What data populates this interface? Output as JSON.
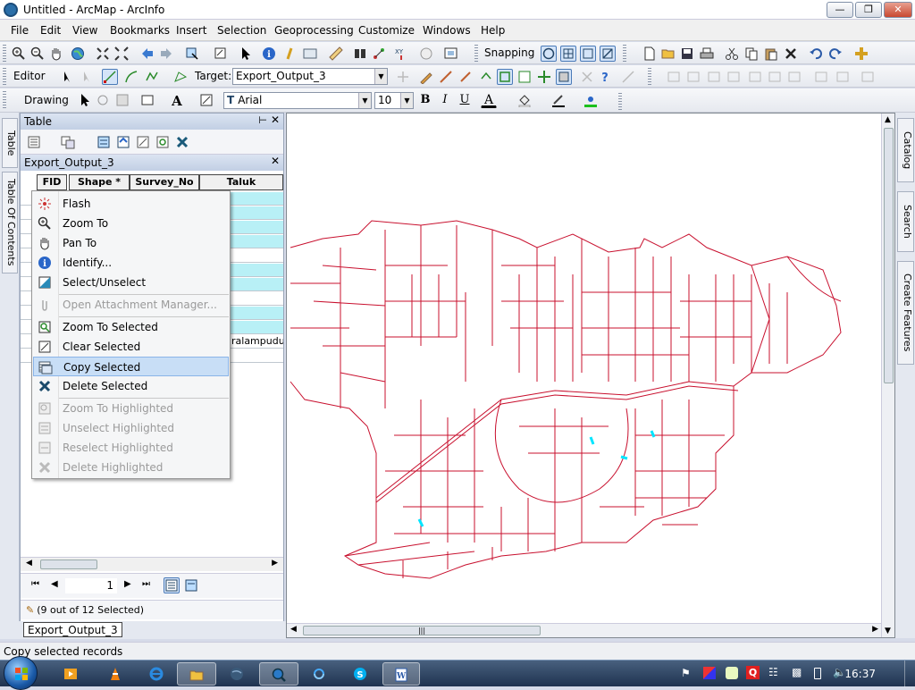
{
  "window": {
    "title": "Untitled - ArcMap - ArcInfo"
  },
  "menubar": [
    "File",
    "Edit",
    "View",
    "Bookmarks",
    "Insert",
    "Selection",
    "Geoprocessing",
    "Customize",
    "Windows",
    "Help"
  ],
  "toolbar1": {
    "snapping_label": "Snapping"
  },
  "editor_toolbar": {
    "editor_label": "Editor",
    "target_label": "Target:",
    "target_value": "Export_Output_3"
  },
  "drawing_toolbar": {
    "drawing_label": "Drawing",
    "font_name": "Arial",
    "font_size": "10",
    "bold": "B",
    "italic": "I",
    "underline": "U",
    "font_color_letter": "A"
  },
  "left_tabs": {
    "table": "Table",
    "toc": "Table Of Contents"
  },
  "table_window": {
    "title": "Table",
    "layer_name": "Export_Output_3",
    "columns": [
      "FID",
      "Shape *",
      "Survey_No",
      "Taluk"
    ],
    "partial_cell_text": "ralampudur",
    "record_number": "1",
    "selection_status": "(9 out of 12 Selected)"
  },
  "context_menu": {
    "items": [
      {
        "label": "Flash",
        "icon": "flash-icon",
        "enabled": true
      },
      {
        "label": "Zoom To",
        "icon": "zoom-to-icon",
        "enabled": true
      },
      {
        "label": "Pan To",
        "icon": "pan-hand-icon",
        "enabled": true
      },
      {
        "label": "Identify...",
        "icon": "identify-icon",
        "enabled": true
      },
      {
        "label": "Select/Unselect",
        "icon": "select-unselect-icon",
        "enabled": true
      },
      {
        "label": "Open Attachment Manager...",
        "icon": "paperclip-icon",
        "enabled": false
      },
      {
        "label": "Zoom To Selected",
        "icon": "zoom-selected-icon",
        "enabled": true
      },
      {
        "label": "Clear Selected",
        "icon": "clear-selected-icon",
        "enabled": true
      },
      {
        "label": "Copy Selected",
        "icon": "copy-selected-icon",
        "enabled": true,
        "highlighted": true
      },
      {
        "label": "Delete Selected",
        "icon": "delete-x-icon",
        "enabled": true
      },
      {
        "label": "Zoom To Highlighted",
        "icon": "zoom-highlighted-icon",
        "enabled": false
      },
      {
        "label": "Unselect Highlighted",
        "icon": "unselect-highlighted-icon",
        "enabled": false
      },
      {
        "label": "Reselect Highlighted",
        "icon": "reselect-highlighted-icon",
        "enabled": false
      },
      {
        "label": "Delete Highlighted",
        "icon": "delete-highlighted-icon",
        "enabled": false
      }
    ]
  },
  "right_tabs": {
    "catalog": "Catalog",
    "search": "Search",
    "create_features": "Create Features"
  },
  "bottom_tab": "Export_Output_3",
  "status_bar": {
    "message": "Copy selected records"
  },
  "taskbar": {
    "clock": "16:37"
  },
  "colors": {
    "parcel_lines": "#c8102e",
    "selected_parcels": "#00e5ff",
    "selected_rows": "#b8f0f6",
    "menu_highlight": "#c8def6"
  }
}
